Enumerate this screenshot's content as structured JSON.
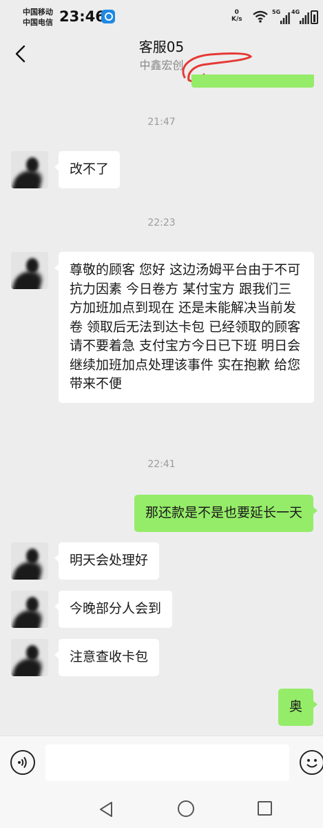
{
  "status_bar": {
    "carrier1": "中国移动",
    "carrier2": "中国电信",
    "time": "23:46",
    "net_speed_value": "0",
    "net_speed_unit": "K/s",
    "signal1_label": "5G",
    "signal2_label": "4G"
  },
  "header": {
    "title": "客服05",
    "subtitle": "中鑫宏创"
  },
  "messages": {
    "timestamps": [
      "21:47",
      "22:23",
      "22:41"
    ],
    "items": [
      {
        "side": "in",
        "text": "改不了"
      },
      {
        "side": "in",
        "text": "尊敬的顾客 您好 这边汤姆平台由于不可抗力因素 今日卷方 某付宝方 跟我们三方加班加点到现在 还是未能解决当前发卷 领取后无法到达卡包 已经领取的顾客 请不要着急 支付宝方今日已下班 明日会继续加班加点处理该事件 实在抱歉 给您带来不便"
      },
      {
        "side": "out",
        "text": "那还款是不是也要延长一天"
      },
      {
        "side": "in",
        "text": "明天会处理好"
      },
      {
        "side": "in",
        "text": "今晚部分人会到"
      },
      {
        "side": "in",
        "text": "注意查收卡包"
      },
      {
        "side": "out",
        "text": "奥"
      }
    ]
  },
  "input": {
    "value": "",
    "placeholder": ""
  },
  "colors": {
    "background": "#ededed",
    "outgoing_bubble": "#95ec69",
    "incoming_bubble": "#ffffff",
    "scribble": "#e53935"
  },
  "icons": {
    "back": "chevron-left-icon",
    "voice": "voice-icon",
    "emoji": "emoji-icon",
    "nav_back": "triangle-back-icon",
    "nav_home": "circle-home-icon",
    "nav_recent": "square-recent-icon"
  }
}
